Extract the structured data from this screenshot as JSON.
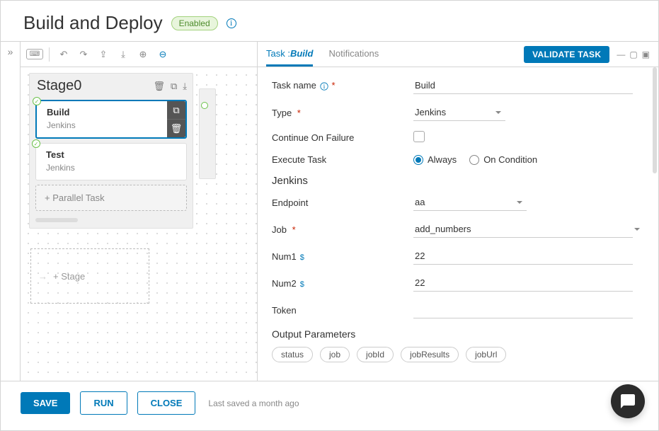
{
  "header": {
    "title": "Build and Deploy",
    "badge": "Enabled"
  },
  "canvas": {
    "stage_name": "Stage0",
    "tasks": [
      {
        "name": "Build",
        "sub": "Jenkins",
        "selected": true
      },
      {
        "name": "Test",
        "sub": "Jenkins",
        "selected": false
      }
    ],
    "add_parallel_label": "+ Parallel Task",
    "add_stage_label": "+ Stage"
  },
  "tabs": {
    "task_prefix": "Task :",
    "task_name_italic": "Build",
    "notifications": "Notifications"
  },
  "validate_label": "VALIDATE TASK",
  "form": {
    "task_name_label": "Task name",
    "task_name_value": "Build",
    "type_label": "Type",
    "type_value": "Jenkins",
    "continue_label": "Continue On Failure",
    "execute_label": "Execute Task",
    "execute_always": "Always",
    "execute_oncond": "On Condition",
    "section_jenkins": "Jenkins",
    "endpoint_label": "Endpoint",
    "endpoint_value": "aa",
    "job_label": "Job",
    "job_value": "add_numbers",
    "num1_label": "Num1",
    "num1_value": "22",
    "num2_label": "Num2",
    "num2_value": "22",
    "token_label": "Token",
    "token_value": "",
    "output_params_title": "Output Parameters",
    "output_params": [
      "status",
      "job",
      "jobId",
      "jobResults",
      "jobUrl"
    ]
  },
  "footer": {
    "save": "SAVE",
    "run": "RUN",
    "close": "CLOSE",
    "last_saved": "Last saved a month ago"
  }
}
